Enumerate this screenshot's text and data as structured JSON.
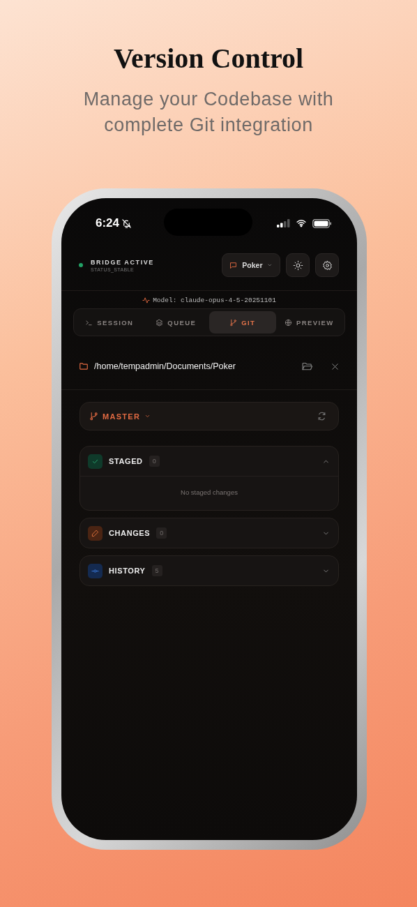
{
  "hero": {
    "title": "Version Control",
    "subtitle": "Manage your Codebase with complete Git integration"
  },
  "status_bar": {
    "time": "6:24",
    "silent": true
  },
  "bridge": {
    "title": "BRIDGE ACTIVE",
    "status": "STATUS_STABLE"
  },
  "project_button": {
    "label": "Poker"
  },
  "model": {
    "text": "Model: claude-opus-4-5-20251101"
  },
  "tabs": [
    {
      "kind": "session",
      "label": "SESSION",
      "selected": false
    },
    {
      "kind": "queue",
      "label": "QUEUE",
      "selected": false
    },
    {
      "kind": "git",
      "label": "GIT",
      "selected": true
    },
    {
      "kind": "preview",
      "label": "PREVIEW",
      "selected": false
    }
  ],
  "path": {
    "text": "/home/tempadmin/Documents/Poker"
  },
  "branch": {
    "label": "MASTER"
  },
  "sections": [
    {
      "kind": "staged",
      "title": "STAGED",
      "count": "0",
      "expanded": true,
      "empty_text": "No staged changes"
    },
    {
      "kind": "changes",
      "title": "CHANGES",
      "count": "0",
      "expanded": false
    },
    {
      "kind": "history",
      "title": "HISTORY",
      "count": "5",
      "expanded": false
    }
  ]
}
